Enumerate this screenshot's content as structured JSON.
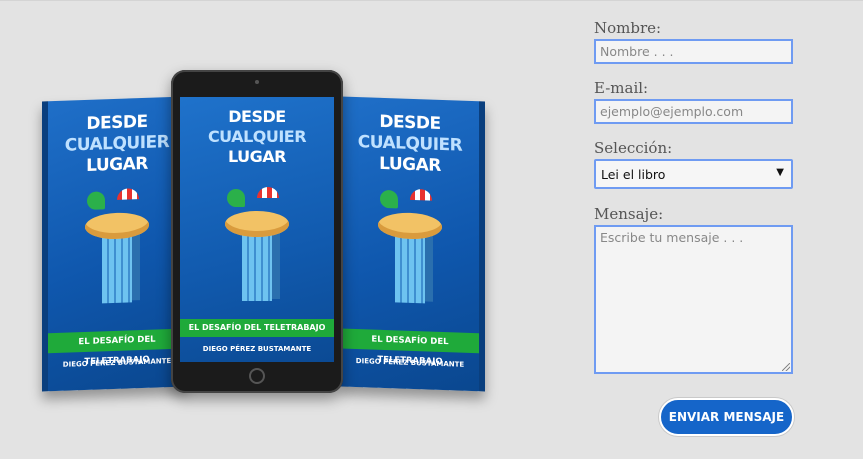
{
  "book": {
    "title_line1": "DESDE",
    "title_line2": "CUALQUIER",
    "title_line3": "LUGAR",
    "subtitle": "EL DESAFÍO DEL TELETRABAJO",
    "author": "DIEGO PÉREZ BUSTAMANTE"
  },
  "form": {
    "name_label": "Nombre:",
    "name_placeholder": "Nombre . . .",
    "email_label": "E-mail:",
    "email_placeholder": "ejemplo@ejemplo.com",
    "selection_label": "Selección:",
    "selection_value": "Lei el libro",
    "message_label": "Mensaje:",
    "message_placeholder": "Escribe tu mensaje . . .",
    "send_label": "ENVIAR MENSAJE"
  },
  "icons": {
    "dropdown": "triangle-down-icon"
  },
  "colors": {
    "background": "#e3e3e3",
    "input_border": "#6f9bf2",
    "button": "#1565c9",
    "book_blue": "#1363b8",
    "banner_green": "#1faa3a"
  }
}
